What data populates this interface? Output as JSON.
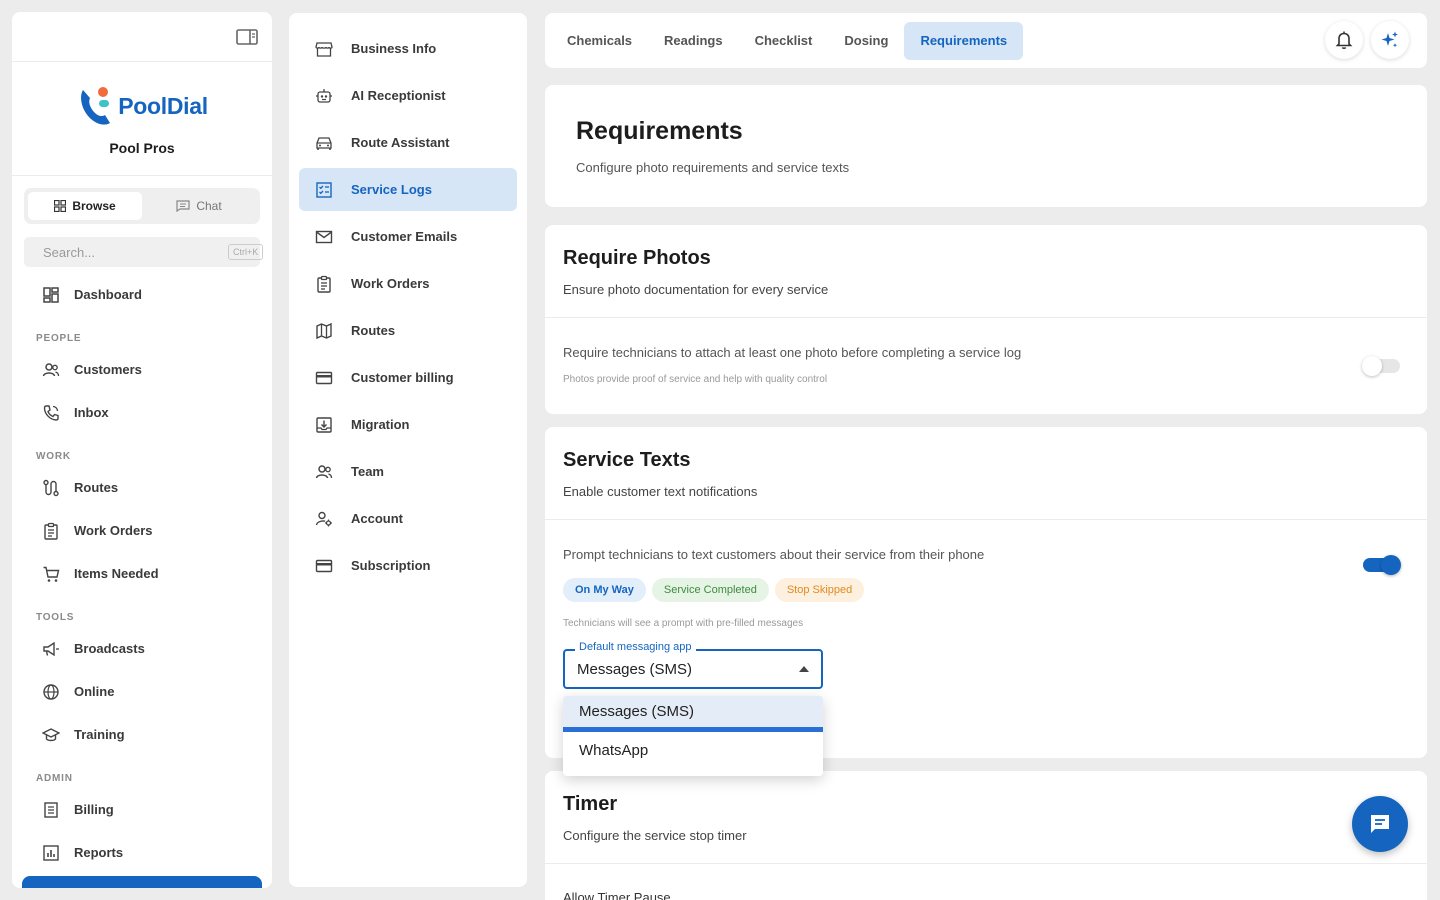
{
  "brand": {
    "logo_text": "PoolDial",
    "org_name": "Pool Pros"
  },
  "sidebar": {
    "segments": [
      {
        "label": "Browse",
        "icon": "grid-icon",
        "active": true
      },
      {
        "label": "Chat",
        "icon": "chat-icon",
        "active": false
      }
    ],
    "search_placeholder": "Search...",
    "search_shortcut": "Ctrl+K",
    "dashboard": "Dashboard",
    "sections": {
      "people": "PEOPLE",
      "work": "WORK",
      "tools": "TOOLS",
      "admin": "ADMIN"
    },
    "items": {
      "customers": "Customers",
      "inbox": "Inbox",
      "routes": "Routes",
      "work_orders": "Work Orders",
      "items_needed": "Items Needed",
      "broadcasts": "Broadcasts",
      "online": "Online",
      "training": "Training",
      "billing": "Billing",
      "reports": "Reports"
    }
  },
  "settings_nav": {
    "items": [
      {
        "label": "Business Info",
        "icon": "store-icon"
      },
      {
        "label": "AI Receptionist",
        "icon": "robot-icon"
      },
      {
        "label": "Route Assistant",
        "icon": "car-icon"
      },
      {
        "label": "Service Logs",
        "icon": "checklist-icon",
        "active": true
      },
      {
        "label": "Customer Emails",
        "icon": "mail-icon"
      },
      {
        "label": "Work Orders",
        "icon": "clipboard-icon"
      },
      {
        "label": "Routes",
        "icon": "map-icon"
      },
      {
        "label": "Customer billing",
        "icon": "card-icon"
      },
      {
        "label": "Migration",
        "icon": "import-icon"
      },
      {
        "label": "Team",
        "icon": "team-icon"
      },
      {
        "label": "Account",
        "icon": "account-settings-icon"
      },
      {
        "label": "Subscription",
        "icon": "card-icon"
      }
    ]
  },
  "tabs": [
    "Chemicals",
    "Readings",
    "Checklist",
    "Dosing",
    "Requirements"
  ],
  "active_tab": "Requirements",
  "page": {
    "title": "Requirements",
    "subtitle": "Configure photo requirements and service texts"
  },
  "require_photos": {
    "title": "Require Photos",
    "subtitle": "Ensure photo documentation for every service",
    "setting_label": "Require technicians to attach at least one photo before completing a service log",
    "setting_note": "Photos provide proof of service and help with quality control",
    "enabled": false
  },
  "service_texts": {
    "title": "Service Texts",
    "subtitle": "Enable customer text notifications",
    "setting_label": "Prompt technicians to text customers about their service from their phone",
    "enabled": true,
    "chips": [
      {
        "label": "On My Way",
        "bg": "#e3eefb",
        "fg": "#1565c0"
      },
      {
        "label": "Service Completed",
        "bg": "#e6f4e6",
        "fg": "#3d8b3d"
      },
      {
        "label": "Stop Skipped",
        "bg": "#fdf0df",
        "fg": "#e08a1e"
      }
    ],
    "chips_note": "Technicians will see a prompt with pre-filled messages",
    "select_label": "Default messaging app",
    "select_value": "Messages (SMS)",
    "options": [
      "Messages (SMS)",
      "WhatsApp"
    ]
  },
  "timer": {
    "title": "Timer",
    "subtitle": "Configure the service stop timer",
    "row_label": "Allow Timer Pause"
  },
  "colors": {
    "accent": "#1565c0",
    "active_bg": "#d7e6f7"
  }
}
